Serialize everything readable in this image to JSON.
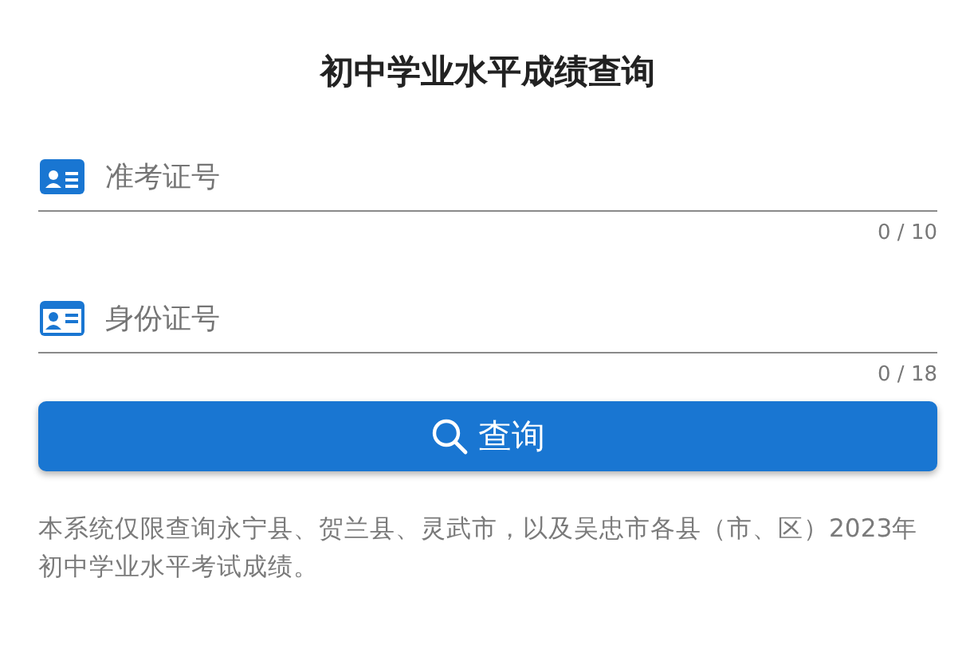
{
  "title": "初中学业水平成绩查询",
  "fields": [
    {
      "placeholder": "准考证号",
      "counter": "0 / 10"
    },
    {
      "placeholder": "身份证号",
      "counter": "0 / 18"
    }
  ],
  "button": {
    "label": "查询"
  },
  "notice": "本系统仅限查询永宁县、贺兰县、灵武市，以及吴忠市各县（市、区）2023年初中学业水平考试成绩。"
}
